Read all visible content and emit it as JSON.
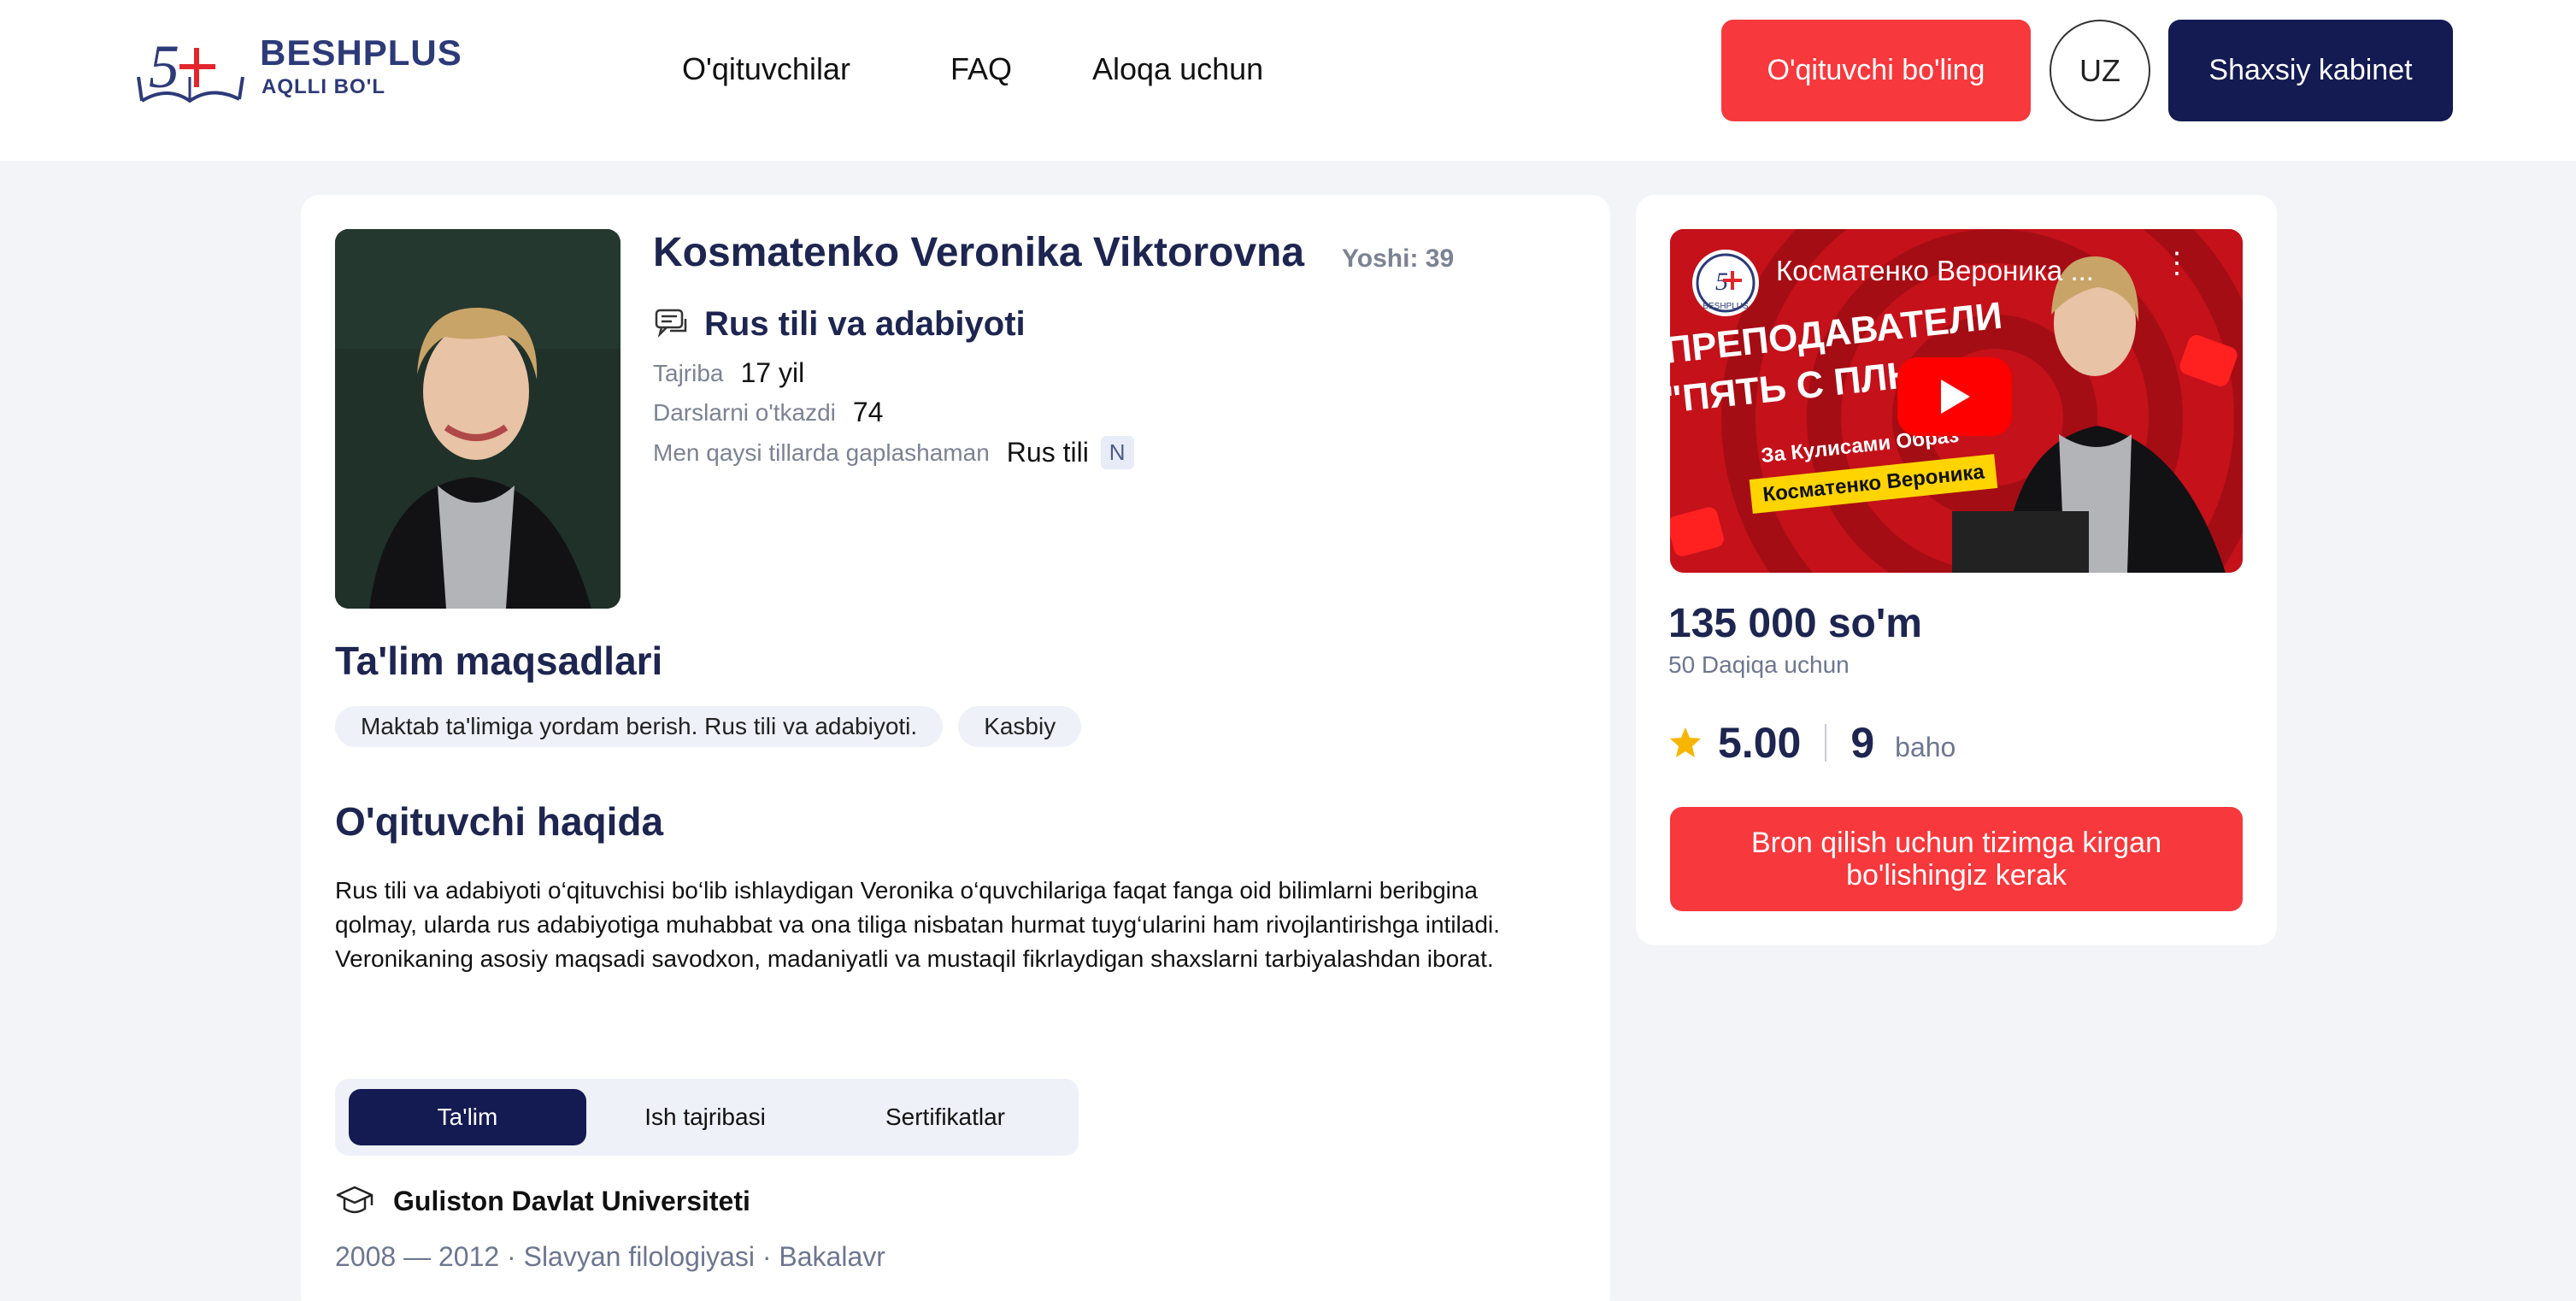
{
  "header": {
    "brand": "BESHPLUS",
    "tagline": "AQLLI BO'L",
    "nav": [
      "O'qituvchilar",
      "FAQ",
      "Aloqa uchun"
    ],
    "become_teacher": "O'qituvchi bo'ling",
    "language": "UZ",
    "cabinet": "Shaxsiy kabinet"
  },
  "teacher": {
    "name": "Kosmatenko Veronika Viktorovna",
    "age_label": "Yoshi: 39",
    "subject": "Rus tili va adabiyoti",
    "experience_label": "Tajriba",
    "experience_value": "17 yil",
    "lessons_label": "Darslarni o'tkazdi",
    "lessons_value": "74",
    "languages_label": "Men qaysi tillarda gaplashaman",
    "language_value": "Rus tili",
    "language_level": "N"
  },
  "goals": {
    "title": "Ta'lim maqsadlari",
    "items": [
      "Maktab ta'limiga yordam berish. Rus tili va adabiyoti.",
      "Kasbiy"
    ]
  },
  "about": {
    "title": "O'qituvchi haqida",
    "text": "Rus tili va adabiyoti o‘qituvchisi bo‘lib ishlaydigan Veronika o‘quvchilariga faqat fanga oid bilimlarni beribgina qolmay, ularda rus adabiyotiga muhabbat va ona tiliga nisbatan hurmat tuyg‘ularini ham rivojlantirishga intiladi. Veronikaning asosiy maqsadi savodxon, madaniyatli va mustaqil fikrlaydigan shaxslarni tarbiyalashdan iborat."
  },
  "tabs": [
    "Ta'lim",
    "Ish tajribasi",
    "Sertifikatlar"
  ],
  "education": {
    "institution": "Guliston Davlat Universiteti",
    "details": "2008 — 2012 · Slavyan filologiyasi · Bakalavr"
  },
  "video": {
    "title": "Косматенко Вероника ...",
    "line1": "ПРЕПОДАВАТЕЛИ",
    "line2": "\"ПЯТЬ С ПЛЮ",
    "subtitle": "За Кулисами Образ",
    "banner": "Косматенко Вероника",
    "logo_text": "BESHPLUS"
  },
  "booking": {
    "price": "135 000 so'm",
    "duration": "50 Daqiqa uchun",
    "rating": "5.00",
    "reviews": "9",
    "reviews_word": "baho",
    "button": "Bron qilish uchun tizimga kirgan bo'lishingiz kerak"
  },
  "colors": {
    "accent_red": "#f7383c",
    "navy": "#141a52",
    "title_navy": "#1d2550",
    "star": "#f7b500"
  }
}
